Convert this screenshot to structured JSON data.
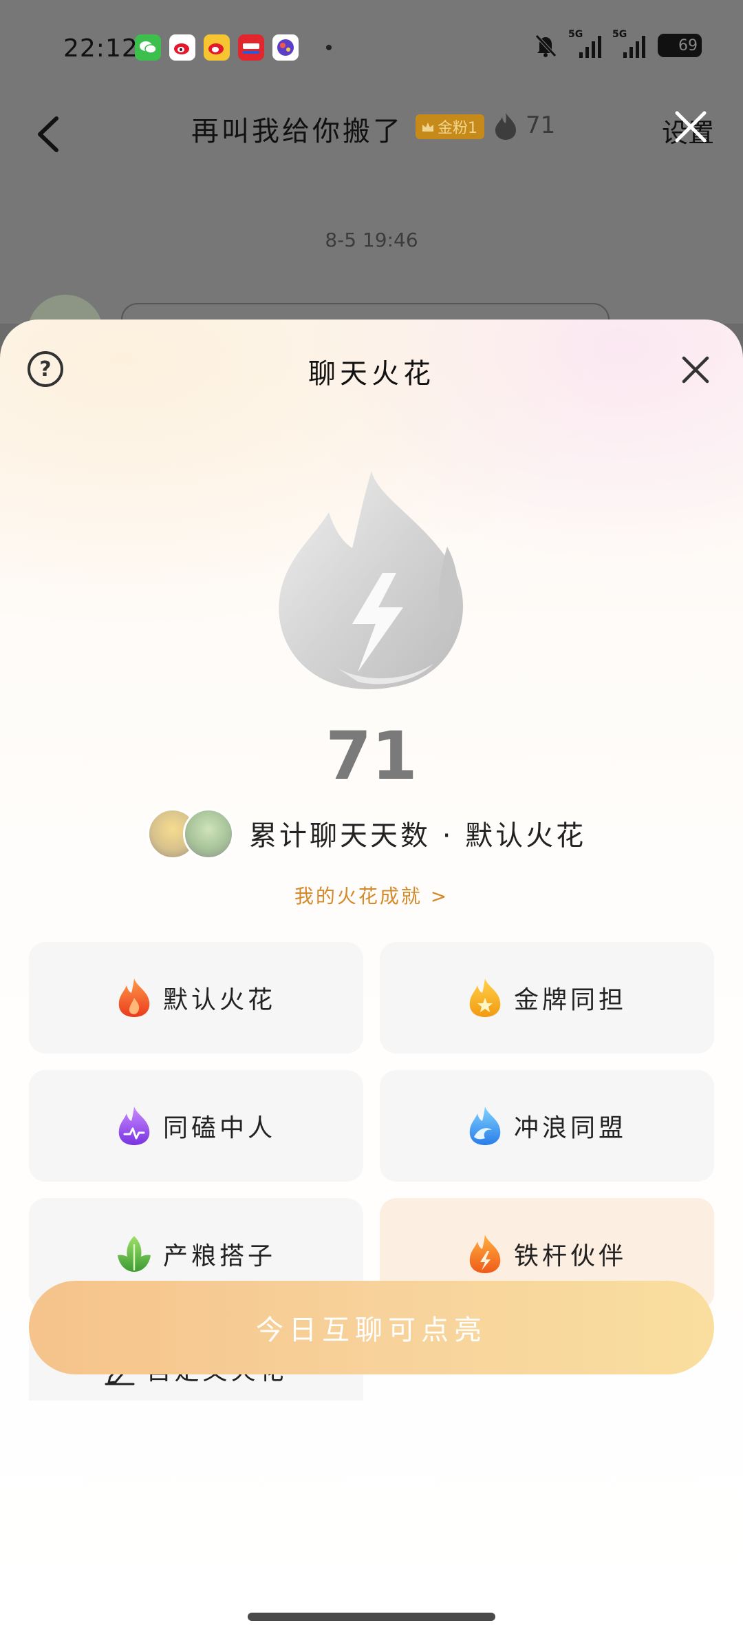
{
  "status_bar": {
    "time": "22:12",
    "network_1": "5G",
    "network_2": "5G",
    "battery": "69"
  },
  "chat_header": {
    "title": "再叫我给你搬了",
    "fan_badge": "金粉1",
    "spark_count": "71",
    "settings_label": "设置"
  },
  "chat": {
    "date": "8-5 19:46"
  },
  "sheet": {
    "help_symbol": "?",
    "title": "聊天火花",
    "count": "71",
    "subtitle": "累计聊天天数 · 默认火花",
    "achievements_link": "我的火花成就 >",
    "options": [
      {
        "label": "默认火花",
        "icon": "flame-orange-icon",
        "color": "#f25a28"
      },
      {
        "label": "金牌同担",
        "icon": "flame-gold-star-icon",
        "color": "#f6a81d"
      },
      {
        "label": "同磕中人",
        "icon": "flame-purple-icon",
        "color": "#8c49e8"
      },
      {
        "label": "冲浪同盟",
        "icon": "flame-wave-blue-icon",
        "color": "#2f8ff0"
      },
      {
        "label": "产粮搭子",
        "icon": "leaf-green-icon",
        "color": "#4fae3c"
      },
      {
        "label": "铁杆伙伴",
        "icon": "flame-bolt-orange-icon",
        "color": "#f07a1e"
      },
      {
        "label": "自定义火花",
        "icon": "pencil-icon",
        "color": "#222222"
      }
    ],
    "selected_option": "铁杆伙伴",
    "cta_label": "今日互聊可点亮"
  },
  "colors": {
    "accent": "#d48a2a",
    "cta_start": "#f5c38b",
    "cta_end": "#f9de9f",
    "flame_gray": "#c9c9c9"
  }
}
